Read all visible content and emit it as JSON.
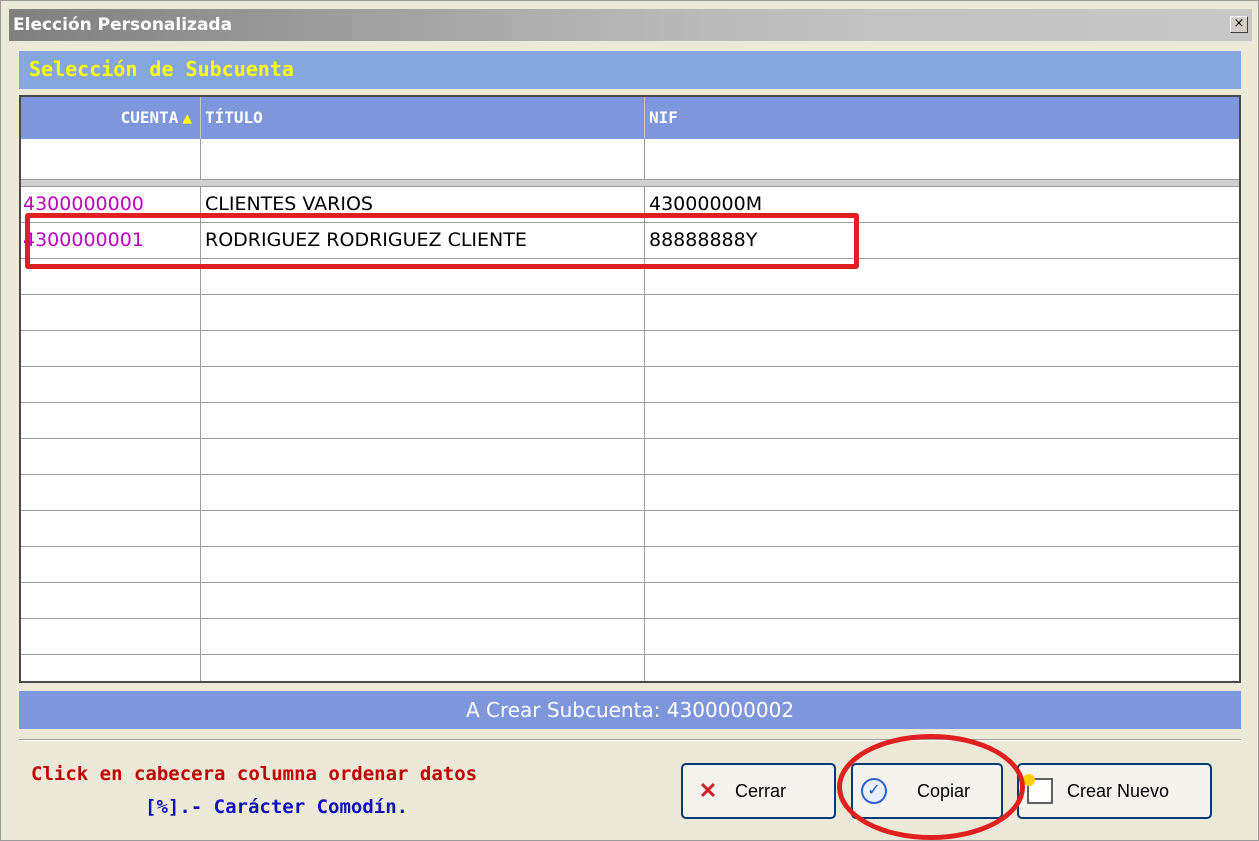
{
  "window": {
    "title": "Elección Personalizada",
    "close_glyph": "×"
  },
  "header": {
    "title": "Selección de Subcuenta"
  },
  "grid": {
    "columns": [
      {
        "label": "CUENTA",
        "sort": "▲"
      },
      {
        "label": "TÍTULO"
      },
      {
        "label": "NIF"
      }
    ],
    "rows": [
      {
        "cuenta": "4300000000",
        "titulo": "CLIENTES VARIOS",
        "nif": "43000000M"
      },
      {
        "cuenta": "4300000001",
        "titulo": "RODRIGUEZ RODRIGUEZ CLIENTE",
        "nif": "88888888Y"
      }
    ]
  },
  "status": {
    "text": "A Crear Subcuenta: 4300000002"
  },
  "hints": {
    "line1": "Click en cabecera columna ordenar datos",
    "line2": "[%].- Carácter Comodín."
  },
  "buttons": {
    "cerrar": "Cerrar",
    "copiar": "Copiar",
    "crear_nuevo": "Crear Nuevo"
  },
  "icons": {
    "close": "close-icon",
    "cerrar": "x-icon",
    "copiar": "check-circle-icon",
    "crear_nuevo": "new-document-icon"
  },
  "colors": {
    "header_band": "#86a6e0",
    "grid_header": "#7e96dc",
    "header_text": "#ffff00",
    "account_text": "#c000c0",
    "hint_red": "#c00000",
    "hint_blue": "#1010c0",
    "highlight": "#e02020"
  }
}
